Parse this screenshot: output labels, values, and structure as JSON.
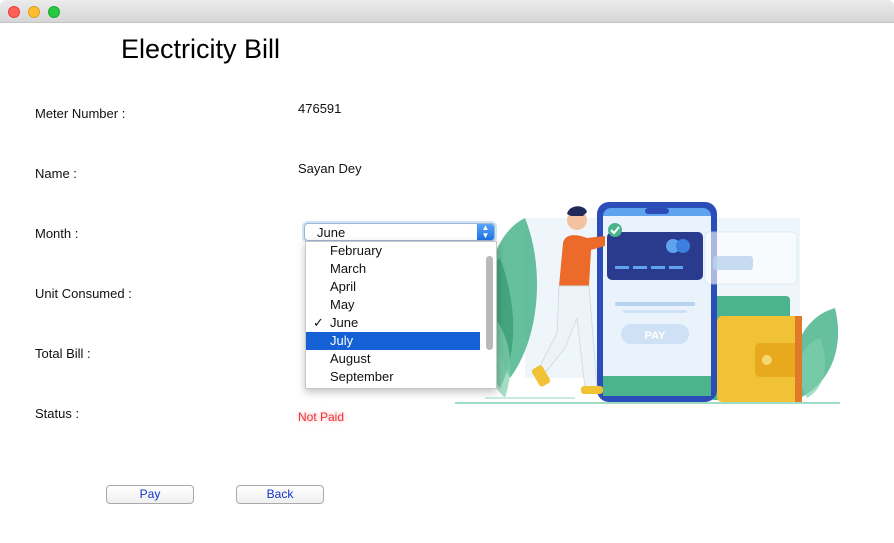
{
  "window": {
    "title": ""
  },
  "header": {
    "title": "Electricity Bill"
  },
  "fields": {
    "meter_label": "Meter Number :",
    "meter_value": "476591",
    "name_label": "Name :",
    "name_value": "Sayan Dey",
    "month_label": "Month :",
    "unit_label": "Unit Consumed :",
    "total_label": "Total Bill :",
    "status_label": "Status :",
    "status_value": "Not Paid"
  },
  "month_select": {
    "selected": "June",
    "options": [
      "February",
      "March",
      "April",
      "May",
      "June",
      "July",
      "August",
      "September"
    ],
    "checked_option": "June",
    "highlighted_option": "July",
    "check_mark": "✓"
  },
  "buttons": {
    "pay": "Pay",
    "back": "Back"
  },
  "illustration": {
    "pay_label": "PAY"
  },
  "colors": {
    "status": "#e8343a",
    "highlight": "#1560d4",
    "button_text": "#1530c8",
    "phone": "#3d7fe0",
    "card": "#2a3a8c",
    "shirt": "#ec6a2a",
    "wallet": "#f2c236",
    "leaf": "#4bb48c"
  }
}
